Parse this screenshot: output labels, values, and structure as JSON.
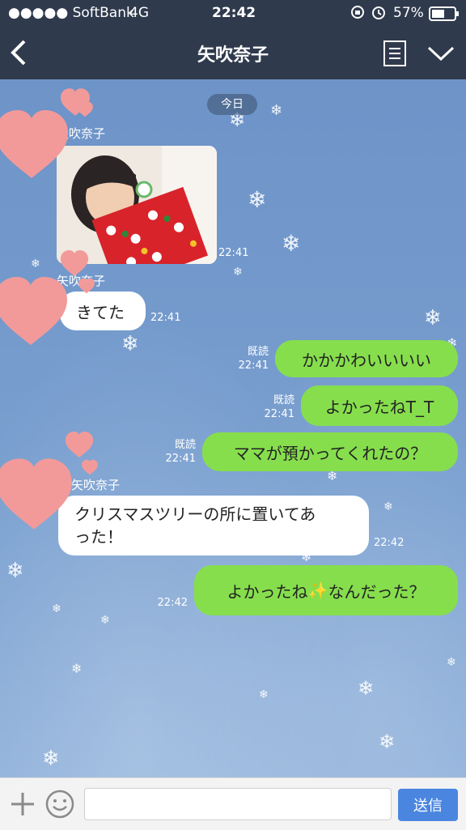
{
  "status_bar": {
    "carrier": "●●●●● SoftBank",
    "network": "4G",
    "time": "22:42",
    "battery": "57%"
  },
  "header": {
    "title": "矢吹奈子"
  },
  "chat": {
    "date_label": "今日",
    "messages": [
      {
        "sender": "矢吹奈子",
        "type": "image",
        "time": "22:41"
      },
      {
        "sender": "矢吹奈子",
        "text": "きてた",
        "time": "22:41"
      },
      {
        "read": "既読",
        "text": "かかかわいいいい",
        "time": "22:41"
      },
      {
        "read": "既読",
        "text": "よかったねT_T",
        "time": "22:41"
      },
      {
        "read": "既読",
        "text": "ママが預かってくれたの？",
        "time": "22:41"
      },
      {
        "sender": "矢吹奈子",
        "line1": "クリスマスツリーの所に置いてあ",
        "line2": "った！",
        "time": "22:42"
      },
      {
        "text_before": "よかったね",
        "emoji": "✨",
        "text_after": "なんだった？",
        "time": "22:42"
      }
    ]
  },
  "input": {
    "send_label": "送信",
    "placeholder": ""
  },
  "colors": {
    "header_bg": "#2f3a4d",
    "outgoing": "#86de4d",
    "send": "#4a86e0"
  }
}
